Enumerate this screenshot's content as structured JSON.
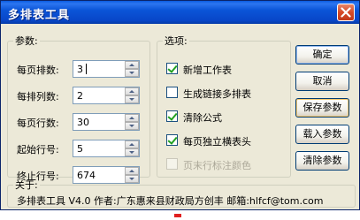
{
  "window": {
    "title": "多排表工具"
  },
  "params": {
    "legend": "参数:",
    "fields": [
      {
        "label": "每页排数:",
        "value": "3"
      },
      {
        "label": "每排列数:",
        "value": "2"
      },
      {
        "label": "每页行数:",
        "value": "30"
      },
      {
        "label": "起始行号:",
        "value": "5"
      },
      {
        "label": "终止行号:",
        "value": "674"
      }
    ]
  },
  "options": {
    "legend": "选项:",
    "items": [
      {
        "label": "新增工作表",
        "checked": true,
        "disabled": false
      },
      {
        "label": "生成链接多排表",
        "checked": false,
        "disabled": false
      },
      {
        "label": "清除公式",
        "checked": true,
        "disabled": false
      },
      {
        "label": "每页独立横表头",
        "checked": true,
        "disabled": false
      },
      {
        "label": "页末行标注颜色",
        "checked": false,
        "disabled": true
      }
    ]
  },
  "buttons": {
    "ok": "确定",
    "cancel": "取消",
    "save": "保存参数",
    "load": "载入参数",
    "clear": "清除参数"
  },
  "about": {
    "legend": "关于:",
    "text": "多排表工具 V4.0  作者:广东惠来县财政局方创丰  邮箱:hlfcf@tom.com"
  },
  "colors": {
    "title_bar": "#0b55d8",
    "close_button": "#d64a27",
    "dialog_face": "#ece9d8",
    "check_mark": "#21a121"
  }
}
